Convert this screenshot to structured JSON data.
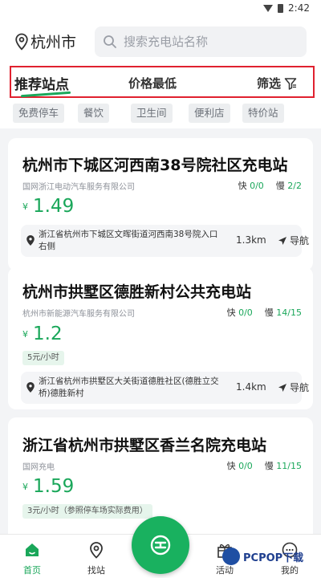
{
  "status_bar": {
    "time": "2:42"
  },
  "header": {
    "city": "杭州市",
    "search_placeholder": "搜索充电站名称"
  },
  "tabs": {
    "recommended": "推荐站点",
    "lowest_price": "价格最低",
    "filter": "筛选"
  },
  "chips": [
    "免费停车",
    "餐饮",
    "卫生间",
    "便利店",
    "特价站"
  ],
  "stations": [
    {
      "name": "杭州市下城区河西南38号院社区充电站",
      "company": "国网浙江电动汽车服务有限公司",
      "fast_label": "快",
      "fast_count": "0/0",
      "slow_label": "慢",
      "slow_count": "2/2",
      "currency": "¥",
      "price": "1.49",
      "tag": "",
      "address": "浙江省杭州市下城区文晖街道河西南38号院入口右侧",
      "distance": "1.3km",
      "nav_label": "导航"
    },
    {
      "name": "杭州市拱墅区德胜新村公共充电站",
      "company": "杭州市新能源汽车服务有限公司",
      "fast_label": "快",
      "fast_count": "0/0",
      "slow_label": "慢",
      "slow_count": "14/15",
      "currency": "¥",
      "price": "1.2",
      "tag": "5元/小时",
      "address": "浙江省杭州市拱墅区大关街道德胜社区(德胜立交桥)德胜新村",
      "distance": "1.4km",
      "nav_label": "导航"
    },
    {
      "name": "浙江省杭州市拱墅区香兰名院充电站",
      "company": "国网充电",
      "fast_label": "快",
      "fast_count": "0/0",
      "slow_label": "慢",
      "slow_count": "11/15",
      "currency": "¥",
      "price": "1.59",
      "tag": "3元/小时（参照停车场实际费用）"
    }
  ],
  "bottom_nav": {
    "home": "首页",
    "stations": "找站",
    "activity": "活动",
    "mine": "我的"
  },
  "watermark": "PCPOP下载",
  "colors": {
    "accent": "#1aa75a",
    "highlight_box": "#e0212f"
  }
}
